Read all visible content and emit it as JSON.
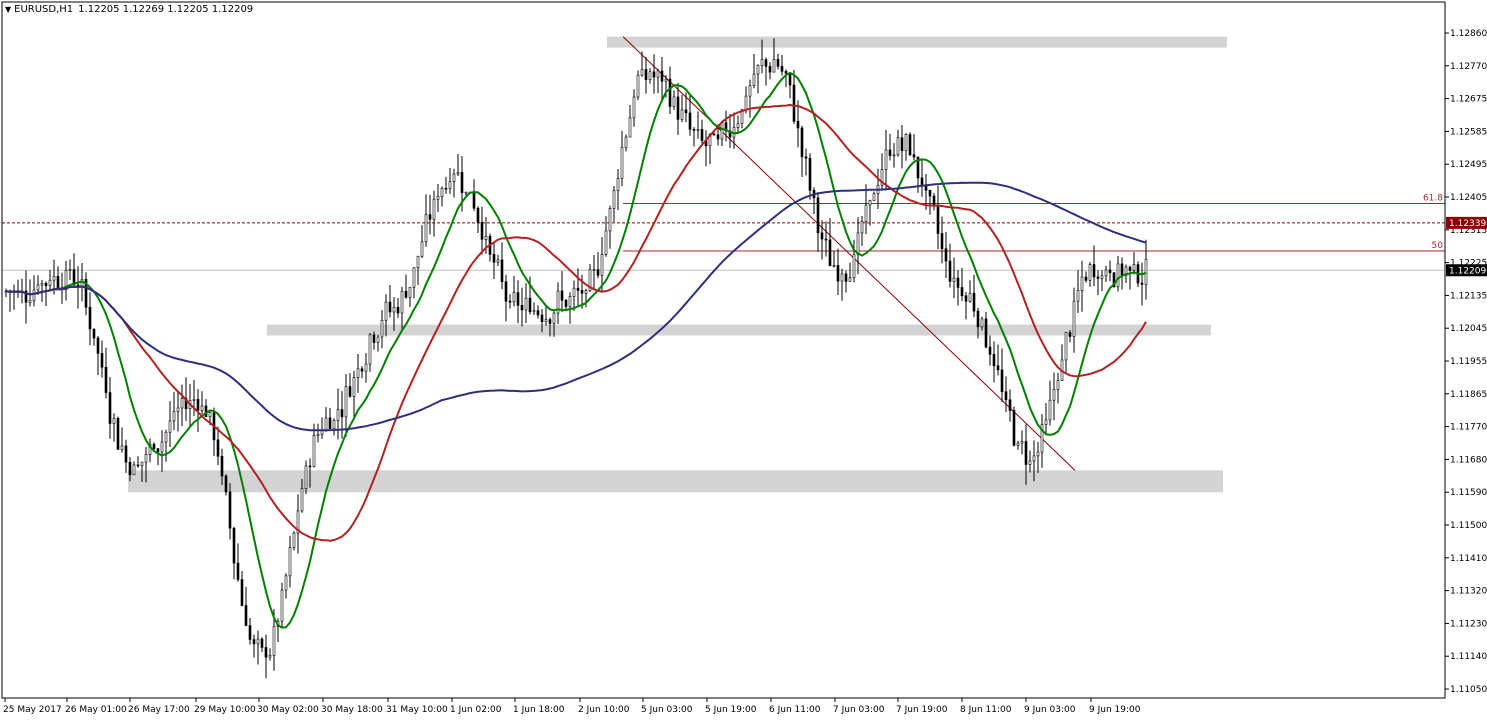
{
  "header": {
    "symbol": "EURUSD,H1",
    "open": "1.12205",
    "high": "1.12269",
    "low": "1.12205",
    "close": "1.12209"
  },
  "chart_data": {
    "type": "candlestick",
    "symbol": "EURUSD",
    "timeframe": "H1",
    "grid": false,
    "y_axis": {
      "position": "right",
      "range": [
        1.11045,
        1.129
      ],
      "ticks": [
        "1.12860",
        "1.12770",
        "1.12675",
        "1.12585",
        "1.12495",
        "1.12405",
        "1.12315",
        "1.12225",
        "1.12135",
        "1.12045",
        "1.11955",
        "1.11865",
        "1.11770",
        "1.11680",
        "1.11590",
        "1.11500",
        "1.11410",
        "1.11320",
        "1.11230",
        "1.11140",
        "1.11050"
      ]
    },
    "x_axis": {
      "ticks": [
        "25 May 2017",
        "26 May 01:00",
        "26 May 17:00",
        "29 May 10:00",
        "30 May 02:00",
        "30 May 18:00",
        "31 May 10:00",
        "1 Jun 02:00",
        "1 Jun 18:00",
        "2 Jun 10:00",
        "5 Jun 03:00",
        "5 Jun 19:00",
        "6 Jun 11:00",
        "7 Jun 03:00",
        "7 Jun 19:00",
        "8 Jun 11:00",
        "9 Jun 03:00",
        "9 Jun 19:00"
      ]
    },
    "price_labels": [
      {
        "text": "1.12339",
        "value": 1.12339,
        "color": "#8b0000"
      },
      {
        "text": "1.12209",
        "value": 1.12209,
        "color": "#000000"
      }
    ],
    "levels": [
      {
        "text": "61.8",
        "value": 1.12392,
        "color": "#a52a2a"
      },
      {
        "text": "50",
        "value": 1.12262,
        "color": "#a52a2a"
      }
    ],
    "zones": [
      {
        "low": 1.1282,
        "high": 1.1285
      },
      {
        "low": 1.1203,
        "high": 1.1206
      },
      {
        "low": 1.116,
        "high": 1.1166
      }
    ],
    "trendline": {
      "from": 1.1285,
      "to": 1.1166
    },
    "moving_averages": [
      {
        "color": "#008000",
        "role": "fast"
      },
      {
        "color": "#b22222",
        "role": "medium"
      },
      {
        "color": "#2f2f7f",
        "role": "slow"
      }
    ],
    "key_points": [
      {
        "time": "25 May 2017",
        "price": 1.1215
      },
      {
        "time": "26 May 01:00",
        "price": 1.122
      },
      {
        "time": "26 May 17:00",
        "price": 1.1168
      },
      {
        "time": "29 May 10:00",
        "price": 1.1186
      },
      {
        "time": "30 May 02:00",
        "price": 1.1114
      },
      {
        "time": "30 May 18:00",
        "price": 1.118
      },
      {
        "time": "31 May 10:00",
        "price": 1.121
      },
      {
        "time": "1 Jun 02:00",
        "price": 1.1248
      },
      {
        "time": "1 Jun 18:00",
        "price": 1.121
      },
      {
        "time": "2 Jun 10:00",
        "price": 1.1213
      },
      {
        "time": "5 Jun 03:00",
        "price": 1.1275
      },
      {
        "time": "5 Jun 19:00",
        "price": 1.1255
      },
      {
        "time": "6 Jun 11:00",
        "price": 1.1278
      },
      {
        "time": "7 Jun 03:00",
        "price": 1.122
      },
      {
        "time": "7 Jun 19:00",
        "price": 1.1256
      },
      {
        "time": "8 Jun 11:00",
        "price": 1.1215
      },
      {
        "time": "9 Jun 03:00",
        "price": 1.117
      },
      {
        "time": "9 Jun 19:00",
        "price": 1.12209
      }
    ]
  }
}
